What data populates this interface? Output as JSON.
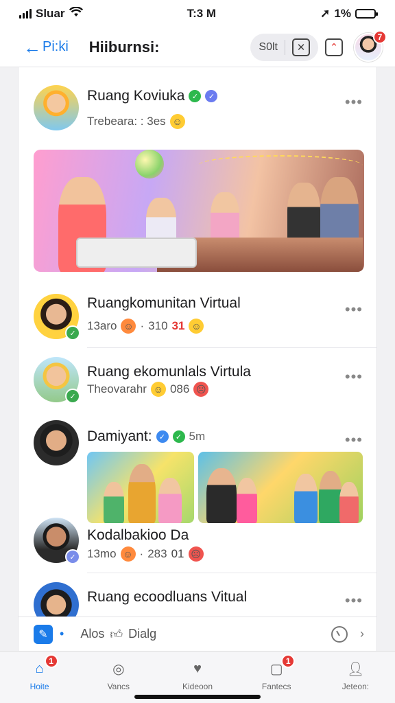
{
  "status_bar": {
    "carrier": "Sluar",
    "time": "T:3 M",
    "battery": "1%"
  },
  "header": {
    "back_label": "Pi:ki",
    "title": "Hiiburnsi:",
    "pill_label": "S0lt",
    "profile_badge": "7"
  },
  "posts": [
    {
      "name": "Ruang Koviuka",
      "meta": "Trebeara: : 3es"
    },
    {
      "name": "Ruangkomunitan Virtual",
      "meta_a": "13aro",
      "meta_b": "310",
      "meta_c": "31"
    },
    {
      "name": "Ruang ekomunlals Virtula",
      "meta_a": "Theovarahr",
      "meta_b": "086"
    },
    {
      "name": "Damiyant:",
      "time": "5m"
    },
    {
      "name": "Kodalbakioo Da",
      "meta_a": "13mo",
      "meta_b": "283",
      "meta_c": "01"
    },
    {
      "name": "Ruang ecoodluans Vitual"
    }
  ],
  "action_bar": {
    "label_a": "Alos",
    "label_b": "Dialg"
  },
  "tabs": [
    {
      "label": "Hoite",
      "icon": "home-icon",
      "badge": "1"
    },
    {
      "label": "Vancs",
      "icon": "compass-icon"
    },
    {
      "label": "Kideoon",
      "icon": "heart-icon"
    },
    {
      "label": "Fantecs",
      "icon": "bell-icon",
      "badge": "1"
    },
    {
      "label": "Jeteon:",
      "icon": "person-icon"
    }
  ],
  "colors": {
    "accent": "#1a7be9",
    "badge": "#e53935",
    "verified_green": "#2db84d"
  }
}
